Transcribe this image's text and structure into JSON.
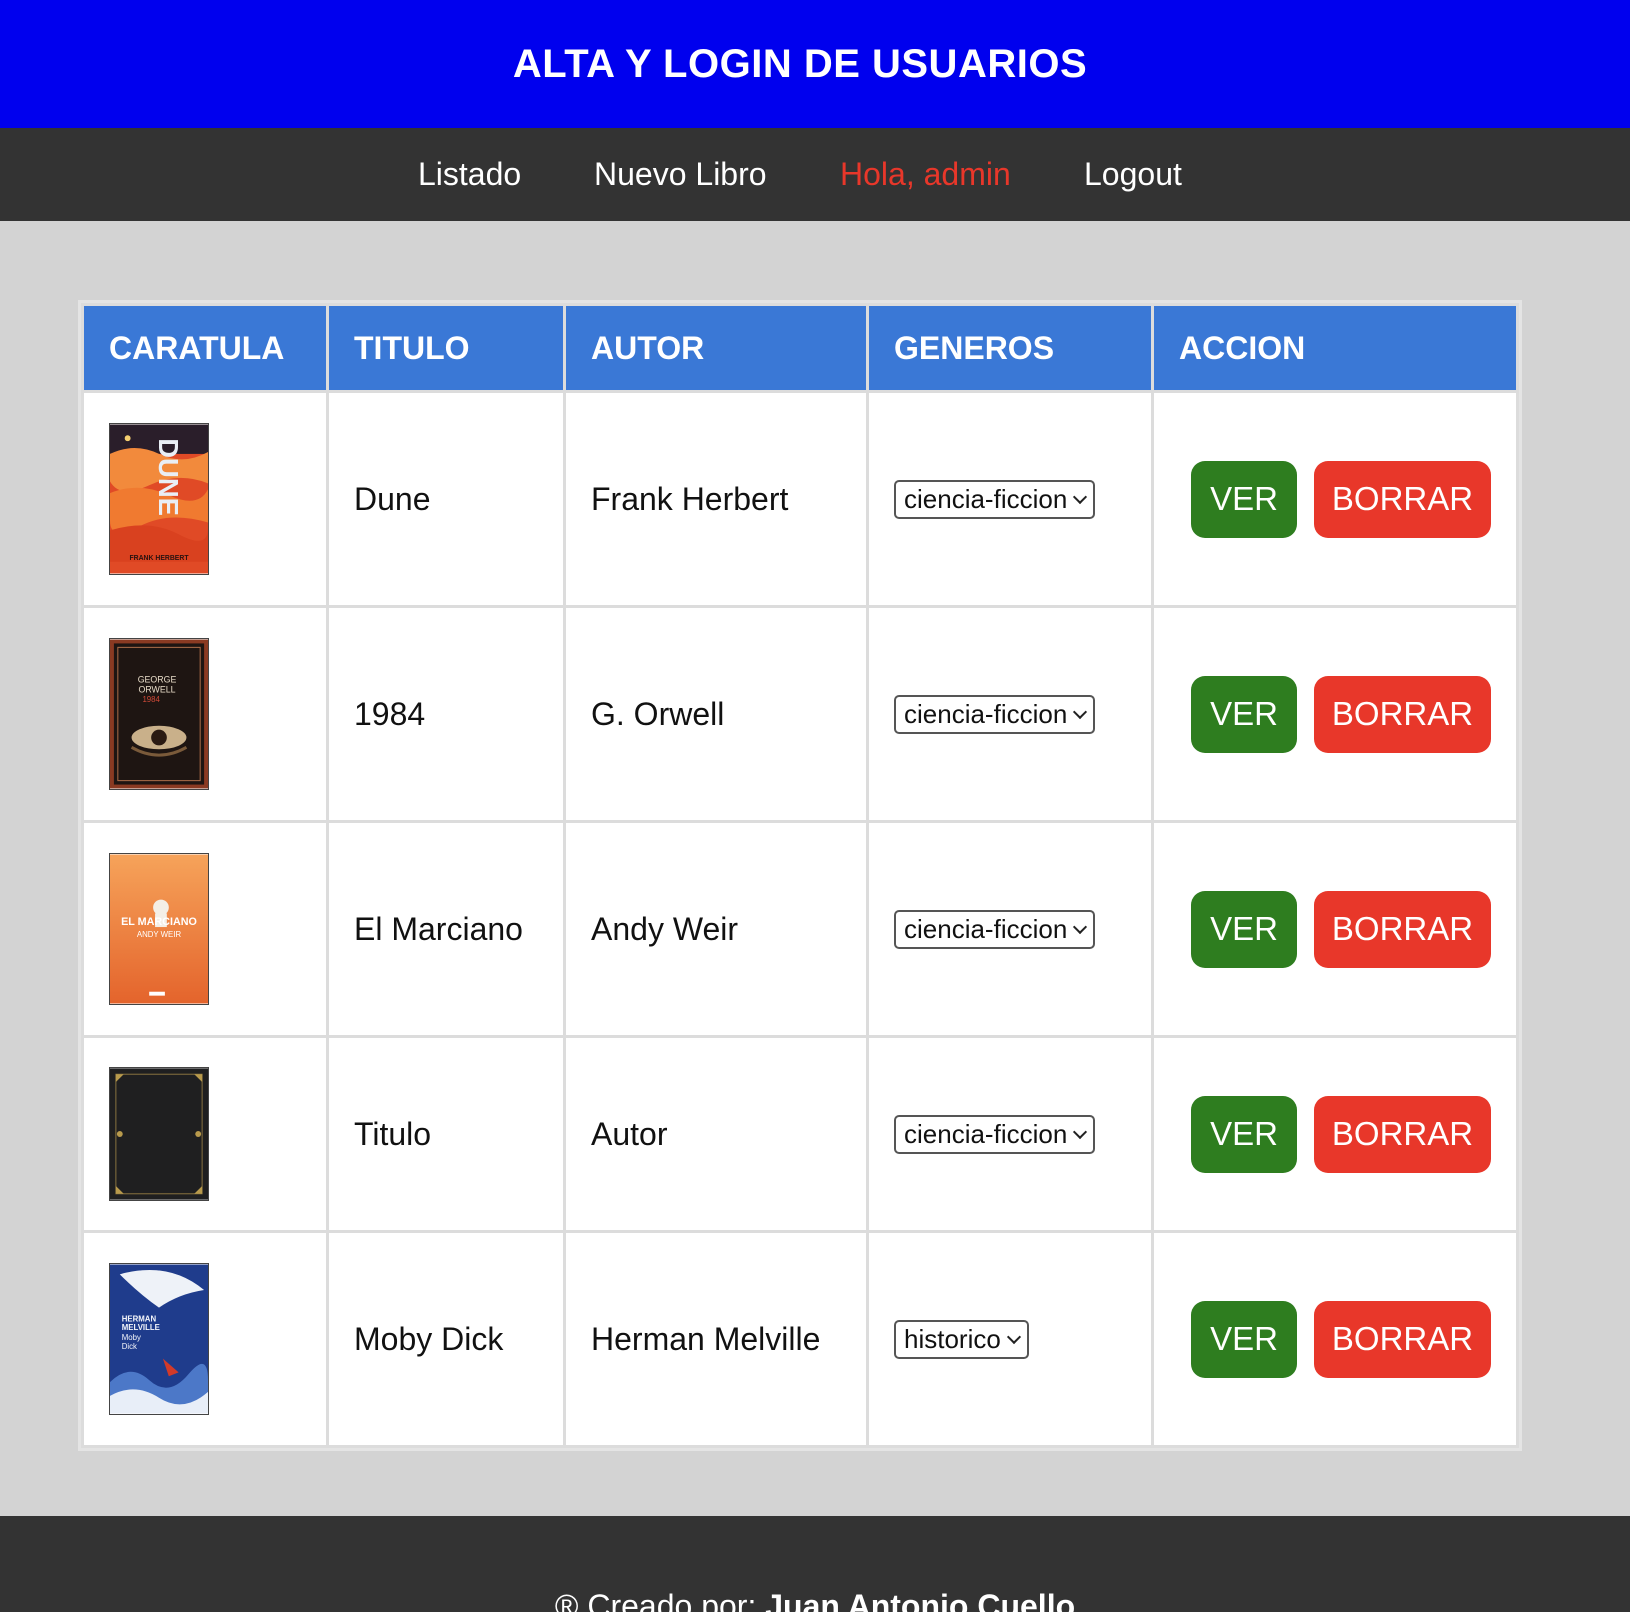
{
  "header": {
    "title": "ALTA Y LOGIN DE USUARIOS"
  },
  "nav": {
    "listado": "Listado",
    "nuevo_libro": "Nuevo Libro",
    "greeting": "Hola, admin",
    "logout": "Logout"
  },
  "table": {
    "headers": [
      "CARATULA",
      "TITULO",
      "AUTOR",
      "GENEROS",
      "ACCION"
    ],
    "rows": [
      {
        "cover": "dune-cover",
        "titulo": "Dune",
        "autor": "Frank Herbert",
        "genero": "ciencia-ficcion",
        "ver": "VER",
        "borrar": "BORRAR",
        "cover_text": [
          "DUNE",
          "FRANK HERBERT"
        ]
      },
      {
        "cover": "1984-cover",
        "titulo": "1984",
        "autor": "G. Orwell",
        "genero": "ciencia-ficcion",
        "ver": "VER",
        "borrar": "BORRAR",
        "cover_text": [
          "GEORGE",
          "ORWELL",
          "1984"
        ]
      },
      {
        "cover": "el-marciano-cover",
        "titulo": "El Marciano",
        "autor": "Andy Weir",
        "genero": "ciencia-ficcion",
        "ver": "VER",
        "borrar": "BORRAR",
        "cover_text": [
          "EL MARCIANO",
          "ANDY WEIR"
        ]
      },
      {
        "cover": "generic-book-cover",
        "titulo": "Titulo",
        "autor": "Autor",
        "genero": "ciencia-ficcion",
        "ver": "VER",
        "borrar": "BORRAR"
      },
      {
        "cover": "moby-dick-cover",
        "titulo": "Moby Dick",
        "autor": "Herman Melville",
        "genero": "historico",
        "ver": "VER",
        "borrar": "BORRAR",
        "cover_text": [
          "HERMAN",
          "MELVILLE",
          "Moby",
          "Dick"
        ]
      }
    ]
  },
  "footer": {
    "prefix": "® Creado por: ",
    "author": "Juan Antonio Cuello"
  },
  "colors": {
    "header": "#0000ee",
    "nav": "#333333",
    "active_nav": "#e8372a",
    "th": "#3a78d6",
    "ver": "#2e7d1f",
    "borrar": "#e8372a"
  }
}
